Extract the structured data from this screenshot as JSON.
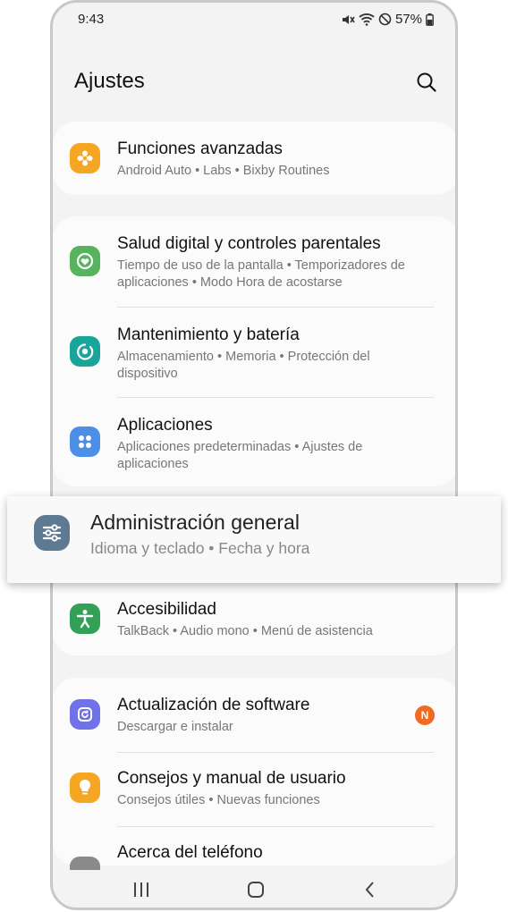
{
  "status": {
    "time": "9:43",
    "battery": "57%"
  },
  "header": {
    "title": "Ajustes"
  },
  "items": [
    {
      "title": "Funciones avanzadas",
      "sub": "Android Auto  •  Labs  •  Bixby Routines",
      "color": "#f5a623"
    },
    {
      "title": "Salud digital y controles parentales",
      "sub": "Tiempo de uso de la pantalla  •  Temporizadores de aplicaciones  •  Modo Hora de acostarse",
      "color": "#56b35e"
    },
    {
      "title": "Mantenimiento y batería",
      "sub": "Almacenamiento  •  Memoria  •  Protección del dispositivo",
      "color": "#1aa59a"
    },
    {
      "title": "Aplicaciones",
      "sub": "Aplicaciones predeterminadas  •  Ajustes de aplicaciones",
      "color": "#4d8fe6"
    },
    {
      "title": "Accesibilidad",
      "sub": "TalkBack  •  Audio mono  •  Menú de asistencia",
      "color": "#33a058"
    },
    {
      "title": "Actualización de software",
      "sub": "Descargar e instalar",
      "color": "#6f72e8"
    },
    {
      "title": "Consejos y manual de usuario",
      "sub": "Consejos útiles  •  Nuevas funciones",
      "color": "#f5a623"
    },
    {
      "title": "Acerca del teléfono",
      "sub": "",
      "color": "#8a8a8a"
    }
  ],
  "highlight": {
    "title": "Administración general",
    "sub": "Idioma y teclado  •  Fecha y hora",
    "color": "#5d7a92"
  },
  "badge": "N",
  "icons": [
    "mute-icon",
    "wifi-icon",
    "no-disturb-icon",
    "battery-icon",
    "search-icon",
    "navigation-back-icon",
    "home-icon",
    "recent-apps-icon"
  ]
}
